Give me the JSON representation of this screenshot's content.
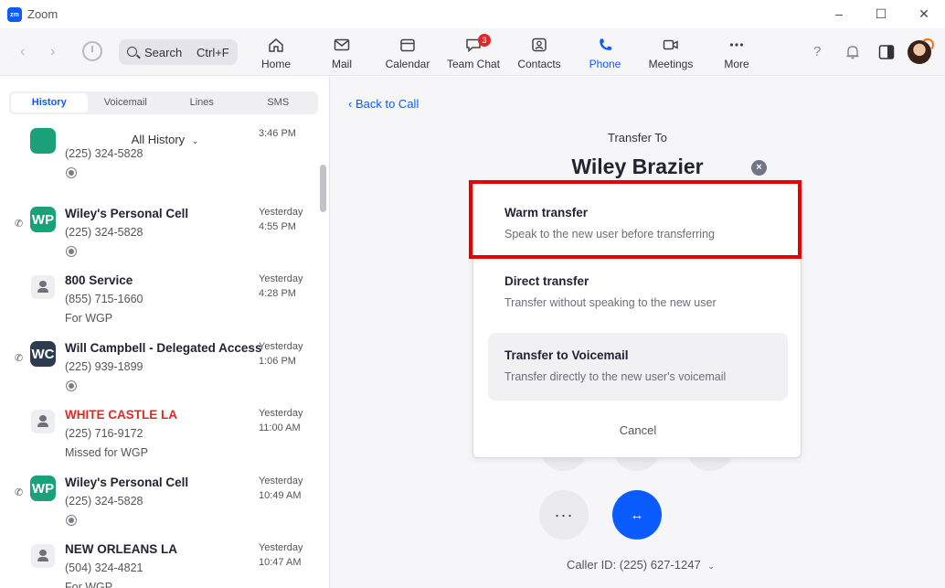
{
  "window": {
    "title": "Zoom",
    "logo_text": "zm"
  },
  "toolbar": {
    "search_label": "Search",
    "search_shortcut": "Ctrl+F",
    "nav": [
      {
        "label": "Home",
        "icon": "home-icon"
      },
      {
        "label": "Mail",
        "icon": "mail-icon"
      },
      {
        "label": "Calendar",
        "icon": "calendar-icon"
      },
      {
        "label": "Team Chat",
        "icon": "chat-icon",
        "badge": "3"
      },
      {
        "label": "Contacts",
        "icon": "contacts-icon"
      },
      {
        "label": "Phone",
        "icon": "phone-icon",
        "active": true
      },
      {
        "label": "Meetings",
        "icon": "video-icon"
      },
      {
        "label": "More",
        "icon": "more-icon"
      }
    ]
  },
  "left": {
    "tabs": [
      "History",
      "Voicemail",
      "Lines",
      "SMS"
    ],
    "active_tab": "History",
    "filter_label": "All History",
    "calls": [
      {
        "initials": "",
        "name": "",
        "number": "(225) 324-5828",
        "extra": "",
        "day": "",
        "time": "3:46 PM",
        "avatar": "green",
        "recording": true
      },
      {
        "initials": "WP",
        "name": "Wiley's Personal Cell",
        "number": "(225) 324-5828",
        "extra": "",
        "day": "Yesterday",
        "time": "4:55 PM",
        "avatar": "green",
        "recording": true
      },
      {
        "initials": "",
        "name": "800 Service",
        "number": "(855) 715-1660",
        "extra": "For WGP",
        "day": "Yesterday",
        "time": "4:28 PM",
        "avatar": "grey",
        "recording": false
      },
      {
        "initials": "WC",
        "name": "Will Campbell - Delegated Access",
        "number": "(225) 939-1899",
        "extra": "",
        "day": "Yesterday",
        "time": "1:06 PM",
        "avatar": "dark",
        "recording": true
      },
      {
        "initials": "",
        "name": "WHITE CASTLE LA",
        "number": "(225) 716-9172",
        "extra": "Missed for WGP",
        "day": "Yesterday",
        "time": "11:00 AM",
        "avatar": "grey",
        "recording": false,
        "missed": true
      },
      {
        "initials": "WP",
        "name": "Wiley's Personal Cell",
        "number": "(225) 324-5828",
        "extra": "",
        "day": "Yesterday",
        "time": "10:49 AM",
        "avatar": "green",
        "recording": true
      },
      {
        "initials": "",
        "name": "NEW ORLEANS LA",
        "number": "(504) 324-4821",
        "extra": "For WGP",
        "day": "Yesterday",
        "time": "10:47 AM",
        "avatar": "grey",
        "recording": false
      }
    ]
  },
  "right": {
    "back_label": "Back to Call",
    "transfer_to_label": "Transfer To",
    "contact_name": "Wiley Brazier",
    "clear_glyph": "×",
    "more_glyph": "···",
    "transfer_glyph": "↔",
    "caller_id": "Caller ID: (225) 627-1247"
  },
  "popup": {
    "options": [
      {
        "title": "Warm transfer",
        "desc": "Speak to the new user before transferring"
      },
      {
        "title": "Direct transfer",
        "desc": "Transfer without speaking to the new user"
      },
      {
        "title": "Transfer to Voicemail",
        "desc": "Transfer directly to the new user's voicemail"
      }
    ],
    "cancel_label": "Cancel"
  },
  "colors": {
    "accent": "#0b5cff",
    "missed": "#e02828",
    "highlight": "#e80000",
    "green_avatar": "#1aa179",
    "dark_avatar": "#2d3b4f"
  }
}
